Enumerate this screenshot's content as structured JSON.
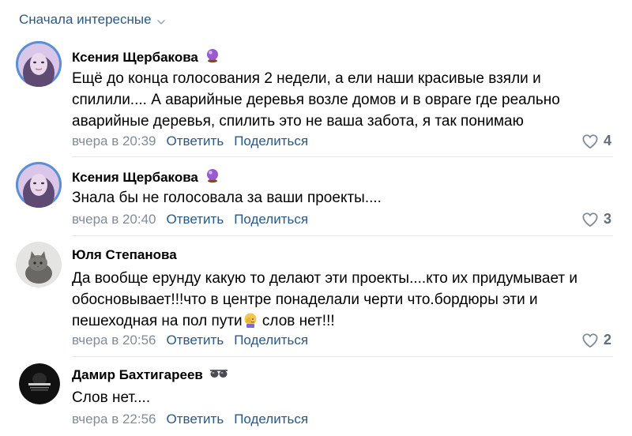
{
  "sort": {
    "label": "Сначала интересные"
  },
  "actions": {
    "reply_label": "Ответить",
    "share_label": "Поделиться"
  },
  "colors": {
    "link": "#2a5885",
    "meta": "#818c99",
    "likes": "#626d7a",
    "divider": "#e7e8ec"
  },
  "comments": [
    {
      "author": "Ксения Щербакова",
      "badge_icon": "crystal-ball-emoji",
      "text": "Ещё до конца голосования 2 недели, а ели наши красивые взяли и спилили.... А аварийные деревья возле домов и в овраге где реально аварийные деревья, спилить это не ваша забота, я так понимаю",
      "time": "вчера в 20:39",
      "likes": "4"
    },
    {
      "author": "Ксения Щербакова",
      "badge_icon": "crystal-ball-emoji",
      "text": "Знала бы не голосовала за ваши проекты....",
      "time": "вчера в 20:40",
      "likes": "3"
    },
    {
      "author": "Юля Степанова",
      "text_before_emoji": "Да вообще ерунду какую то делают эти проекты....кто их придумывает и обосновывает!!!что в центре понаделали черти что.бордюры эти и пешеходная на пол пути",
      "inline_emoji": "facepalm-emoji",
      "text_after_emoji": " слов нет!!!",
      "time": "вчера в 20:56",
      "likes": "2"
    },
    {
      "author": "Дамир Бахтигареев",
      "badge_icon": "sunglasses-emoji",
      "text": "Слов нет....",
      "time": "вчера в 22:56"
    }
  ]
}
